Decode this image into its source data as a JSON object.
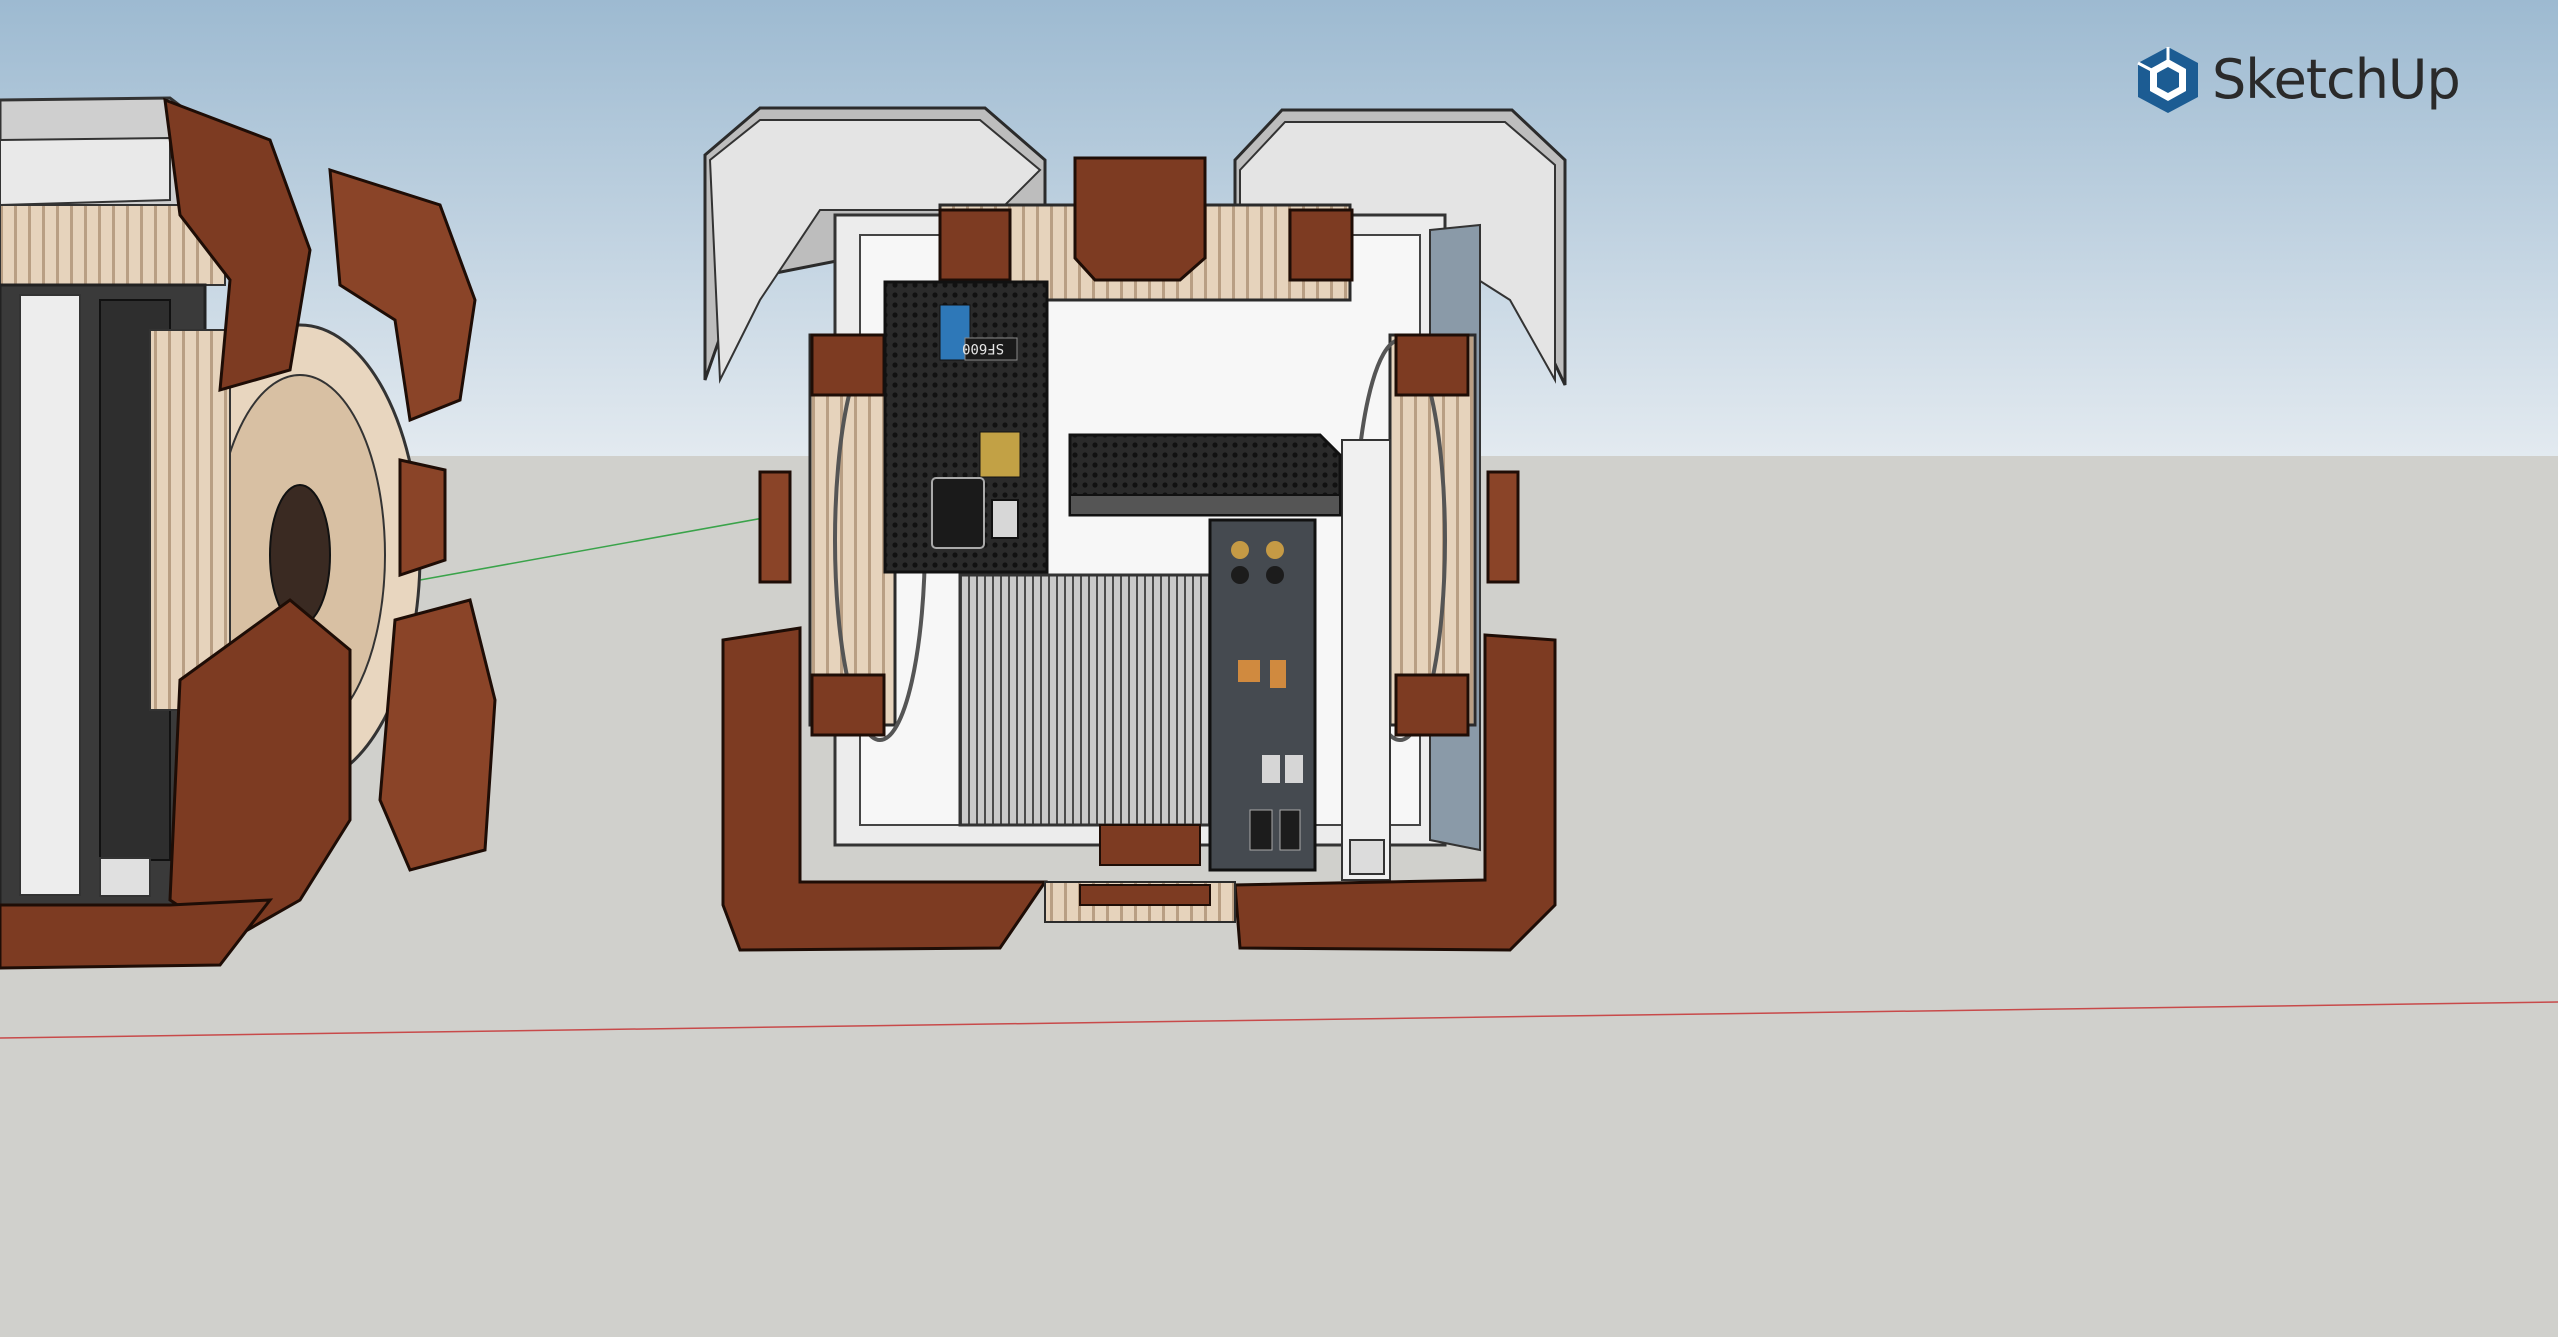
{
  "app": {
    "logo_text": "SketchUp",
    "logo_icon": "sketchup-cube-icon",
    "brand_color": "#1c5c93"
  },
  "scene": {
    "sky_top_color": "#9dbad1",
    "sky_horizon_color": "#e3eaf0",
    "ground_color": "#d0d0cc",
    "accent_wood": "#7d3b22",
    "psu_label": "SF600"
  }
}
